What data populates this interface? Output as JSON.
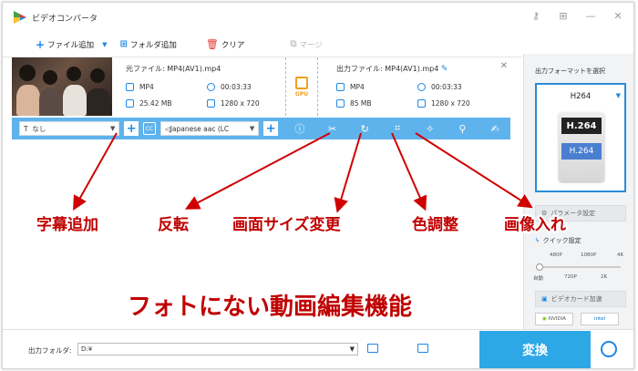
{
  "app": {
    "title": "ビデオコンバータ"
  },
  "window_controls": [
    "key-icon",
    "cart-icon",
    "minimize-icon",
    "close-icon"
  ],
  "toolbar": {
    "add_file": "ファイル追加",
    "add_folder": "フォルダ追加",
    "clear": "クリア",
    "merge": "マージ"
  },
  "file": {
    "source_title": "元ファイル: MP4(AV1).mp4",
    "output_title": "出力ファイル: MP4(AV1).mp4",
    "src_format": "MP4",
    "src_duration": "00:03:33",
    "src_size": "25.42 MB",
    "src_resolution": "1280 x 720",
    "out_format": "MP4",
    "out_duration": "00:03:33",
    "out_size": "85 MB",
    "out_resolution": "1280 x 720",
    "gpu_label": "GPU"
  },
  "editbar": {
    "subtitle_value": "なし",
    "audio_value": "Japanese aac (LC",
    "cc_label": "CC",
    "tools": [
      "info-icon",
      "cut-icon",
      "rotate-icon",
      "crop-icon",
      "effects-icon",
      "watermark-icon",
      "subtitle-edit-icon"
    ]
  },
  "right_panel": {
    "title": "出力フォーマットを選択",
    "format_name": "H264",
    "card_top": "H.264",
    "card_bottom": "H.264",
    "param_settings": "パラメータ設定",
    "quick_settings": "クイック設定",
    "res_top": [
      "480P",
      "1080P",
      "4K"
    ],
    "res_bottom": [
      "自動",
      "720P",
      "2K"
    ],
    "gpu_accel": "ビデオカード加速",
    "vendors": [
      "NVIDIA",
      "intel"
    ]
  },
  "bottom": {
    "output_folder_label": "出力フォルダ:",
    "output_path": "D:¥",
    "convert_label": "変換"
  },
  "annotations": {
    "subtitle_add": "字幕追加",
    "rotate": "反転",
    "crop": "画面サイズ変更",
    "color": "色調整",
    "watermark": "画像入れ",
    "headline": "フォトにない動画編集機能"
  },
  "colors": {
    "accent": "#2ea7e6",
    "editbar": "#5fb3ec",
    "annotation": "#c00000"
  }
}
